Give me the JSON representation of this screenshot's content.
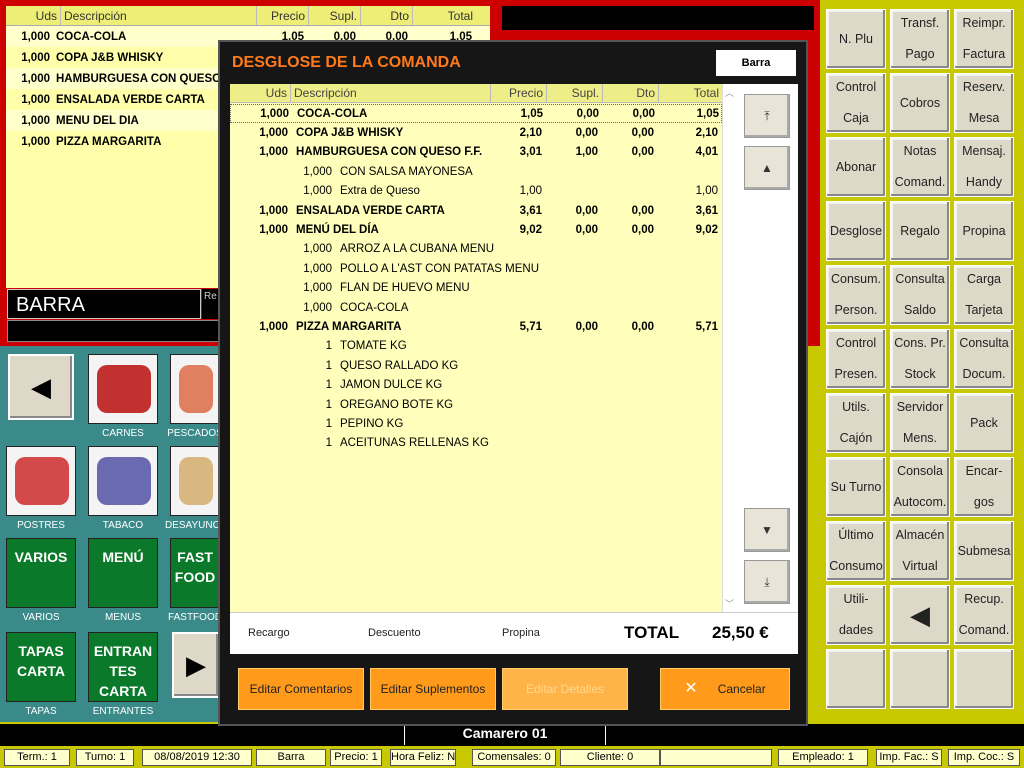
{
  "ticket": {
    "headers": {
      "uds": "Uds",
      "desc": "Descripción",
      "precio": "Precio",
      "supl": "Supl.",
      "dto": "Dto",
      "total": "Total"
    },
    "rows": [
      {
        "qty": "1,000",
        "desc": "COCA-COLA",
        "precio": "1,05",
        "supl": "0,00",
        "dto": "0,00",
        "total": "1,05"
      },
      {
        "qty": "1,000",
        "desc": "COPA J&B  WHISKY"
      },
      {
        "qty": "1,000",
        "desc": "HAMBURGUESA CON QUESO"
      },
      {
        "qty": "1,000",
        "desc": "ENSALADA VERDE CARTA"
      },
      {
        "qty": "1,000",
        "desc": "MENÚ DEL DÍA"
      },
      {
        "qty": "1,000",
        "desc": "PIZZA MARGARITA"
      }
    ],
    "location": "BARRA",
    "location_side": "Re"
  },
  "families": [
    {
      "label": "CARNES",
      "kind": "pic"
    },
    {
      "label": "PESCADOS",
      "kind": "pic"
    },
    {
      "label": "POSTRES",
      "kind": "pic"
    },
    {
      "label": "TABACO",
      "kind": "pic"
    },
    {
      "label": "DESAYUNOS",
      "kind": "pic"
    },
    {
      "label": "VARIOS",
      "tile": "VARIOS"
    },
    {
      "label": "MENÚS",
      "tile": "MENÚ"
    },
    {
      "label": "FASTFOOD",
      "tile": "FAST FOOD"
    },
    {
      "label": "TAPAS",
      "tile": "TAPAS CARTA"
    },
    {
      "label": "ENTRANTES",
      "tile": "ENTRAN TES CARTA"
    }
  ],
  "right_buttons": [
    [
      "N. Plu",
      "Transf. Pago",
      "Reimpr. Factura"
    ],
    [
      "Control Caja",
      "Cobros",
      "Reserv. Mesa"
    ],
    [
      "Abonar",
      "Notas Comand.",
      "Mensaj. Handy"
    ],
    [
      "Desglose",
      "Regalo",
      "Propina"
    ],
    [
      "Consum. Person.",
      "Consulta Saldo",
      "Carga Tarjeta"
    ],
    [
      "Control Presen.",
      "Cons. Pr. Stock",
      "Consulta Docum."
    ],
    [
      "Utils. Cajón",
      "Servidor Mens.",
      "Pack"
    ],
    [
      "Su Turno",
      "Consola Autocom.",
      "Encar- gos"
    ],
    [
      "Último Consumo",
      "Almacén Virtual",
      "Submesa"
    ],
    [
      "Utili- dades",
      "",
      "Recup. Comand."
    ],
    [
      "",
      "",
      ""
    ]
  ],
  "waiter": "Camarero 01",
  "status": [
    "Term.: 1",
    "Turno: 1",
    "08/08/2019 12:30",
    "Barra",
    "Precio: 1",
    "Hora Feliz: N",
    "Comensales: 0",
    "Cliente: 0",
    "",
    "Empleado: 1",
    "Imp. Fac.: S",
    "Imp. Coc.: S"
  ],
  "modal": {
    "title": "DESGLOSE DE LA COMANDA",
    "tag": "Barra",
    "headers": {
      "uds": "Uds",
      "desc": "Descripción",
      "precio": "Precio",
      "supl": "Supl.",
      "dto": "Dto",
      "total": "Total"
    },
    "rows": [
      {
        "level": 0,
        "qty": "1,000",
        "desc": "COCA-COLA",
        "precio": "1,05",
        "supl": "0,00",
        "dto": "0,00",
        "total": "1,05"
      },
      {
        "level": 0,
        "qty": "1,000",
        "desc": "COPA J&B  WHISKY",
        "precio": "2,10",
        "supl": "0,00",
        "dto": "0,00",
        "total": "2,10"
      },
      {
        "level": 0,
        "qty": "1,000",
        "desc": "HAMBURGUESA CON QUESO F.F.",
        "precio": "3,01",
        "supl": "1,00",
        "dto": "0,00",
        "total": "4,01"
      },
      {
        "level": 1,
        "qty": "1,000",
        "desc": "CON SALSA MAYONESA"
      },
      {
        "level": 1,
        "qty": "1,000",
        "desc": "Extra de Queso",
        "precio": "1,00",
        "total": "1,00"
      },
      {
        "level": 0,
        "qty": "1,000",
        "desc": "ENSALADA VERDE CARTA",
        "precio": "3,61",
        "supl": "0,00",
        "dto": "0,00",
        "total": "3,61"
      },
      {
        "level": 0,
        "qty": "1,000",
        "desc": "MENÚ DEL DÍA",
        "precio": "9,02",
        "supl": "0,00",
        "dto": "0,00",
        "total": "9,02"
      },
      {
        "level": 1,
        "qty": "1,000",
        "desc": "ARROZ A LA CUBANA MENU"
      },
      {
        "level": 1,
        "qty": "1,000",
        "desc": "POLLO A L'AST CON PATATAS MENU"
      },
      {
        "level": 1,
        "qty": "1,000",
        "desc": "FLAN DE HUEVO MENU"
      },
      {
        "level": 1,
        "qty": "1,000",
        "desc": "COCA-COLA"
      },
      {
        "level": 0,
        "qty": "1,000",
        "desc": "PIZZA MARGARITA",
        "precio": "5,71",
        "supl": "0,00",
        "dto": "0,00",
        "total": "5,71"
      },
      {
        "level": 2,
        "qty": "1",
        "desc": "TOMATE KG"
      },
      {
        "level": 2,
        "qty": "1",
        "desc": "QUESO RALLADO KG"
      },
      {
        "level": 2,
        "qty": "1",
        "desc": "JAMON DULCE KG"
      },
      {
        "level": 2,
        "qty": "1",
        "desc": "OREGANO BOTE KG"
      },
      {
        "level": 2,
        "qty": "1",
        "desc": "PEPINO KG"
      },
      {
        "level": 2,
        "qty": "1",
        "desc": "ACEITUNAS RELLENAS KG"
      }
    ],
    "footer": {
      "recargo": "Recargo",
      "descuento": "Descuento",
      "propina": "Propina",
      "total_label": "TOTAL",
      "total_value": "25,50 €"
    },
    "buttons": {
      "edit_comments": "Editar Comentarios",
      "edit_supplements": "Editar Suplementos",
      "edit_details": "Editar Detalles",
      "cancel": "Cancelar"
    }
  }
}
